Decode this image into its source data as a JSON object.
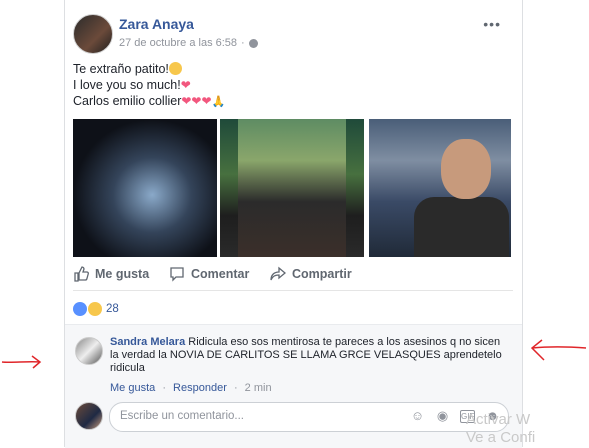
{
  "post": {
    "author": "Zara Anaya",
    "timestamp": "27 de octubre a las 6:58",
    "more_icon": "more-dots-icon",
    "privacy_icon": "globe-icon",
    "text_lines": [
      "Te extraño patito!",
      "I love you so much!",
      "Carlos emilio collier"
    ]
  },
  "actions": {
    "like": "Me gusta",
    "comment": "Comentar",
    "share": "Compartir"
  },
  "reactions": {
    "count": "28"
  },
  "comment": {
    "author": "Sandra Melara",
    "text": "Ridicula eso sos mentirosa te pareces a los asesinos q no sicen la verdad la NOVIA DE CARLITOS SE LLAMA GRCE VELASQUES aprendetelo ridicula",
    "like": "Me gusta",
    "reply": "Responder",
    "time": "2 min",
    "separator": "·"
  },
  "composer": {
    "placeholder": "Escribe un comentario...",
    "icons": [
      "emoji-icon",
      "camera-icon",
      "gif-icon",
      "sticker-icon"
    ]
  },
  "watermark": {
    "line1": "Activar W",
    "line2": "Ve a Confi"
  },
  "colors": {
    "link": "#365899",
    "annotation": "#e0262a"
  }
}
